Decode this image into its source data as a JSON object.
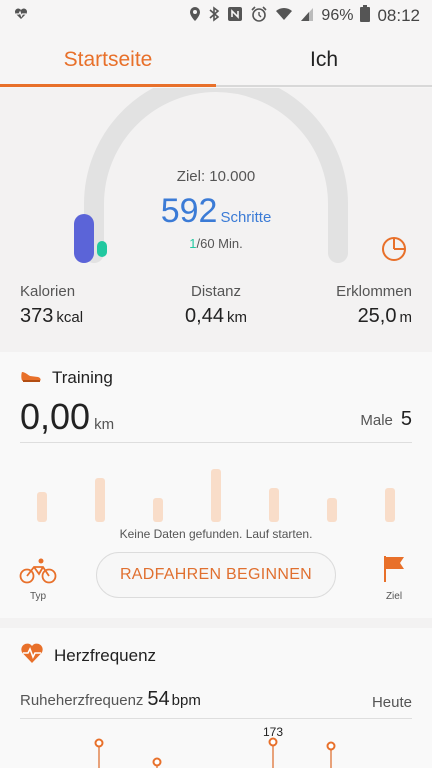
{
  "status_bar": {
    "battery": "96%",
    "time": "08:12",
    "icons": [
      "heart-health-icon",
      "location-icon",
      "bluetooth-icon",
      "nfc-icon",
      "alarm-icon",
      "wifi-icon",
      "signal-icon",
      "battery-icon"
    ]
  },
  "tabs": {
    "home": "Startseite",
    "me": "Ich"
  },
  "steps": {
    "goal": "Ziel: 10.000",
    "count": "592",
    "unit": "Schritte",
    "active_done": "1",
    "active_rest": "/60 Min.",
    "progress_fraction": 0.0592
  },
  "stats": [
    {
      "label": "Kalorien",
      "value": "373",
      "unit": "kcal"
    },
    {
      "label": "Distanz",
      "value": "0,44",
      "unit": "km"
    },
    {
      "label": "Erklommen",
      "value": "25,0",
      "unit": "m"
    }
  ],
  "training": {
    "title": "Training",
    "distance": "0,00",
    "distance_unit": "km",
    "times_label": "Male",
    "times_value": "5",
    "no_data": "Keine Daten gefunden. Lauf starten.",
    "type_label": "Typ",
    "start_button": "RADFAHREN BEGINNEN",
    "goal_label": "Ziel"
  },
  "heart_rate": {
    "title": "Herzfrequenz",
    "resting_label": "Ruheherzfrequenz",
    "resting_value": "54",
    "resting_unit": "bpm",
    "period": "Heute",
    "peak_label": "173"
  },
  "colors": {
    "accent": "#e8702a",
    "steps_blue": "#3b7bd6",
    "active_green": "#21c8a0",
    "gauge_track": "#e2e2e2",
    "gauge_fill": "#5b64d8"
  }
}
